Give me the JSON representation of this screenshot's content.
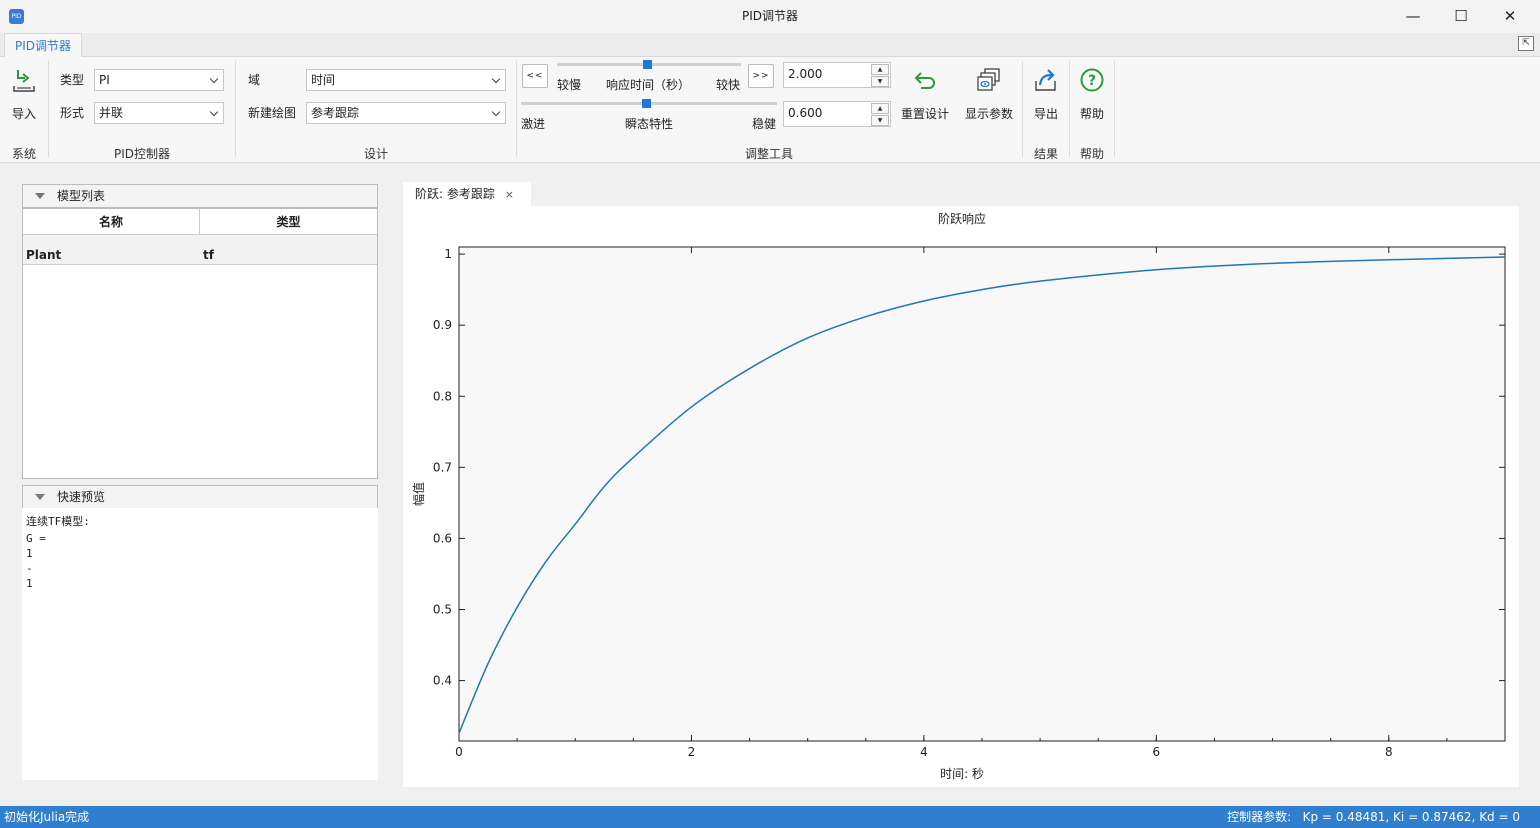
{
  "window": {
    "title": "PID调节器",
    "icon_text": "PID"
  },
  "ribbon": {
    "tab": "PID调节器",
    "system": {
      "import_label": "导入",
      "group": "系统"
    },
    "pid": {
      "type_label": "类型",
      "type_value": "PI",
      "form_label": "形式",
      "form_value": "并联",
      "group": "PID控制器"
    },
    "design": {
      "domain_label": "域",
      "domain_value": "时间",
      "newplot_label": "新建绘图",
      "newplot_value": "参考跟踪",
      "group": "设计"
    },
    "tuning": {
      "slower_btn": "<<",
      "faster_btn": ">>",
      "slow_label": "较慢",
      "response_label": "响应时间（秒）",
      "fast_label": "较快",
      "aggressive_label": "激进",
      "transient_label": "瞬态特性",
      "robust_label": "稳健",
      "response_value": "2.000",
      "transient_value": "0.600",
      "response_slider": 0.49,
      "transient_slider": 0.49,
      "reset_label": "重置设计",
      "show_params_label": "显示参数",
      "group": "调整工具"
    },
    "result": {
      "export_label": "导出",
      "group": "结果"
    },
    "help": {
      "help_label": "帮助",
      "group": "帮助"
    }
  },
  "model_list": {
    "title": "模型列表",
    "columns": [
      "名称",
      "类型"
    ],
    "rows": [
      {
        "name": "Plant",
        "type": "tf"
      }
    ]
  },
  "preview": {
    "title": "快速预览",
    "lines": [
      "连续TF模型:",
      "G =",
      "1",
      "-",
      "1"
    ]
  },
  "plot_tab": {
    "label": "阶跃: 参考跟踪",
    "close": "×"
  },
  "chart_data": {
    "type": "line",
    "title": "阶跃响应",
    "xlabel": "时间: 秒",
    "ylabel": "幅值",
    "xlim": [
      0,
      9
    ],
    "ylim": [
      0.315,
      1.01
    ],
    "xticks": [
      0,
      2,
      4,
      6,
      8
    ],
    "yticks": [
      0.4,
      0.5,
      0.6,
      0.7,
      0.8,
      0.9,
      1
    ],
    "series": [
      {
        "color": "#1f77b4",
        "x": [
          0,
          0.25,
          0.5,
          0.75,
          1,
          1.25,
          1.5,
          2,
          2.5,
          3,
          3.5,
          4,
          4.5,
          5,
          6,
          7,
          8,
          9
        ],
        "y": [
          0.326,
          0.424,
          0.503,
          0.568,
          0.62,
          0.673,
          0.714,
          0.785,
          0.839,
          0.882,
          0.912,
          0.934,
          0.95,
          0.962,
          0.978,
          0.987,
          0.992,
          0.996
        ]
      }
    ]
  },
  "status": {
    "left": "初始化Julia完成",
    "right": "控制器参数:   Kp = 0.48481, Ki = 0.87462, Kd = 0"
  }
}
